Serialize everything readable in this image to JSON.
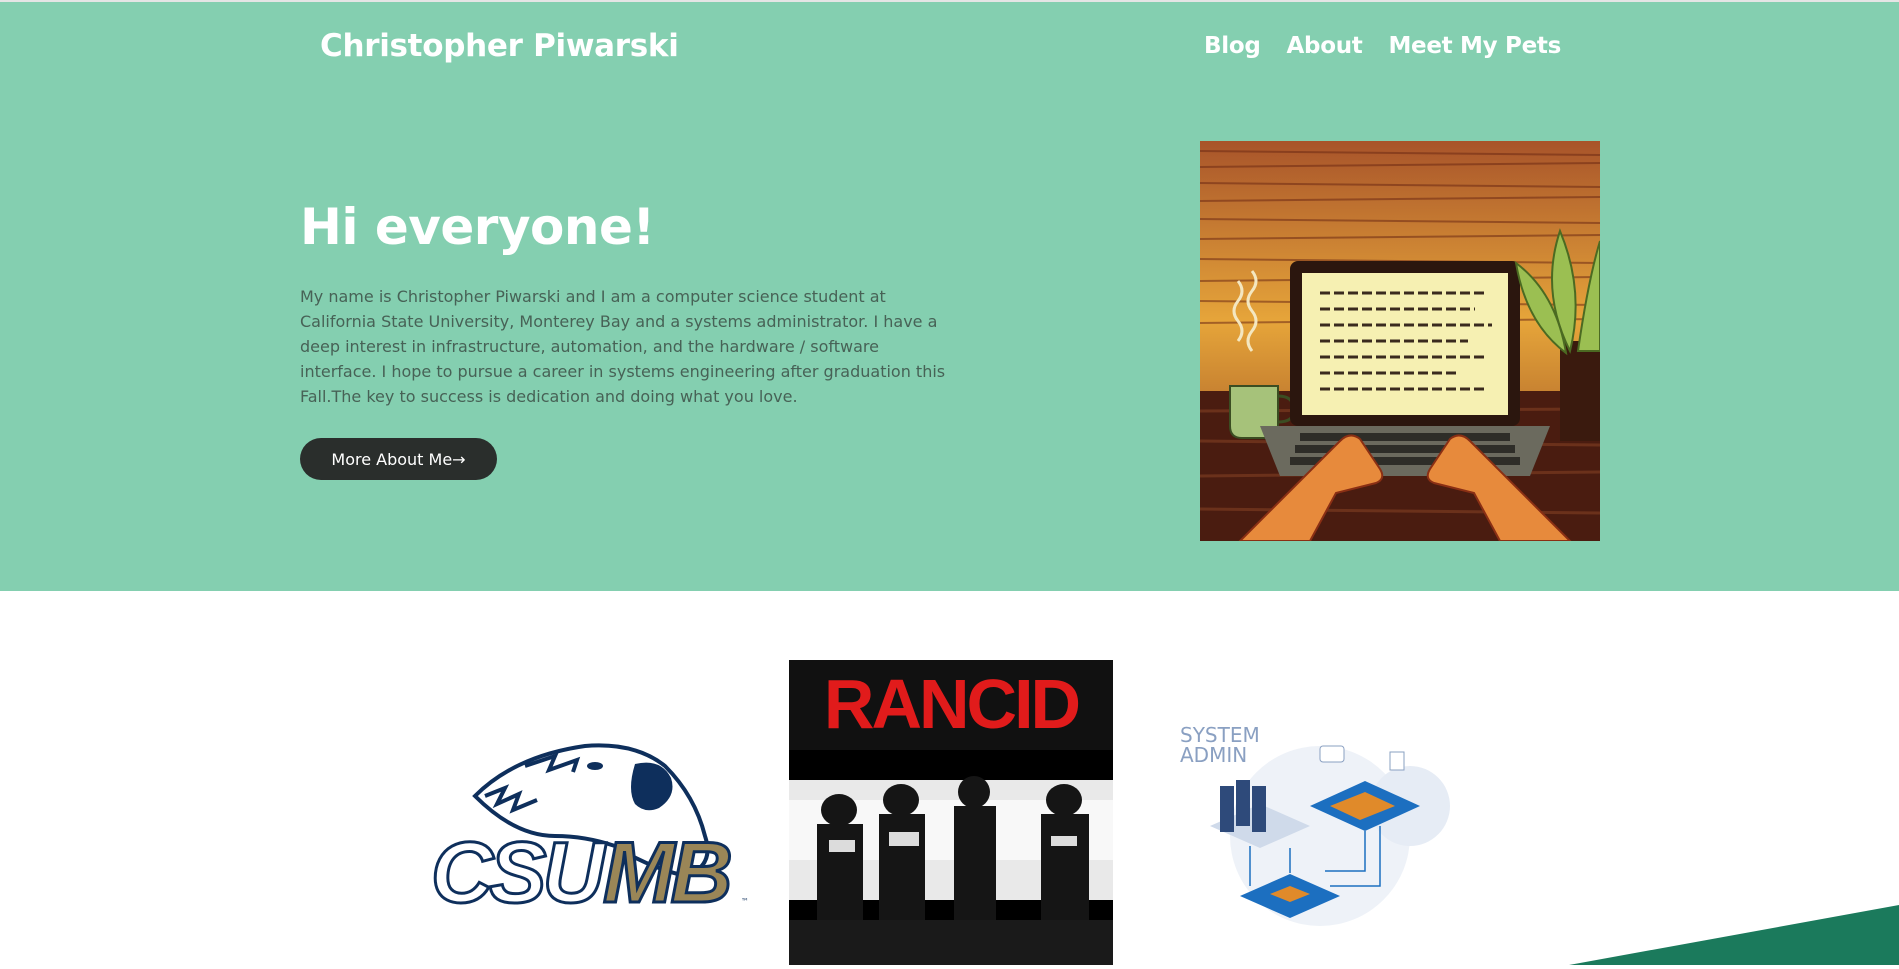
{
  "header": {
    "brand": "Christopher Piwarski",
    "nav": [
      "Blog",
      "About",
      "Meet My Pets"
    ]
  },
  "hero": {
    "headline": "Hi everyone!",
    "intro": "My name is Christopher Piwarski and I am a computer science student at California State University, Monterey Bay and a systems administrator. I have a deep interest in infrastructure, automation, and the hardware / software interface. I hope to pursue a career in systems engineering after graduation this Fall.The key to success is dedication and doing what you love.",
    "cta_label": "More About Me→",
    "illustration": "laptop-typing-illustration"
  },
  "logos": {
    "csumb": {
      "text_outline": "CSU",
      "text_fill": "MB",
      "mark": "™"
    },
    "rancid": {
      "title": "RANCID"
    },
    "sysadmin": {
      "line1": "SYSTEM",
      "line2": "ADMIN"
    }
  },
  "colors": {
    "hero_bg": "#84cfb0",
    "button_bg": "#2a2e2c",
    "accent_stripe": "#1b7a5c",
    "csumb_blue": "#0e2f5c",
    "csumb_gold": "#9a8657",
    "rancid_red": "#e11b1b"
  }
}
